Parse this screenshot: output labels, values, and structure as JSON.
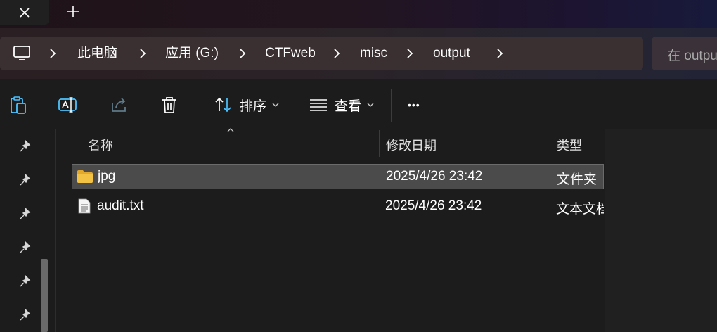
{
  "colors": {
    "background": "#1c1c1c",
    "selection": "#4b4b4b",
    "folder": "#f2c245"
  },
  "tabs": {
    "close_icon": "close-icon",
    "new_tab_icon": "plus-icon"
  },
  "address": {
    "crumbs": [
      "此电脑",
      "应用 (G:)",
      "CTFweb",
      "misc",
      "output"
    ],
    "search_placeholder": "在 output"
  },
  "toolbar": {
    "sort_label": "排序",
    "view_label": "查看",
    "more_label": "•••"
  },
  "columns": {
    "name": "名称",
    "date": "修改日期",
    "type": "类型"
  },
  "files": [
    {
      "name": "jpg",
      "date": "2025/4/26 23:42",
      "type": "文件夹",
      "icon": "folder-icon",
      "selected": true
    },
    {
      "name": "audit.txt",
      "date": "2025/4/26 23:42",
      "type": "文本文档",
      "icon": "text-file-icon",
      "selected": false
    }
  ]
}
